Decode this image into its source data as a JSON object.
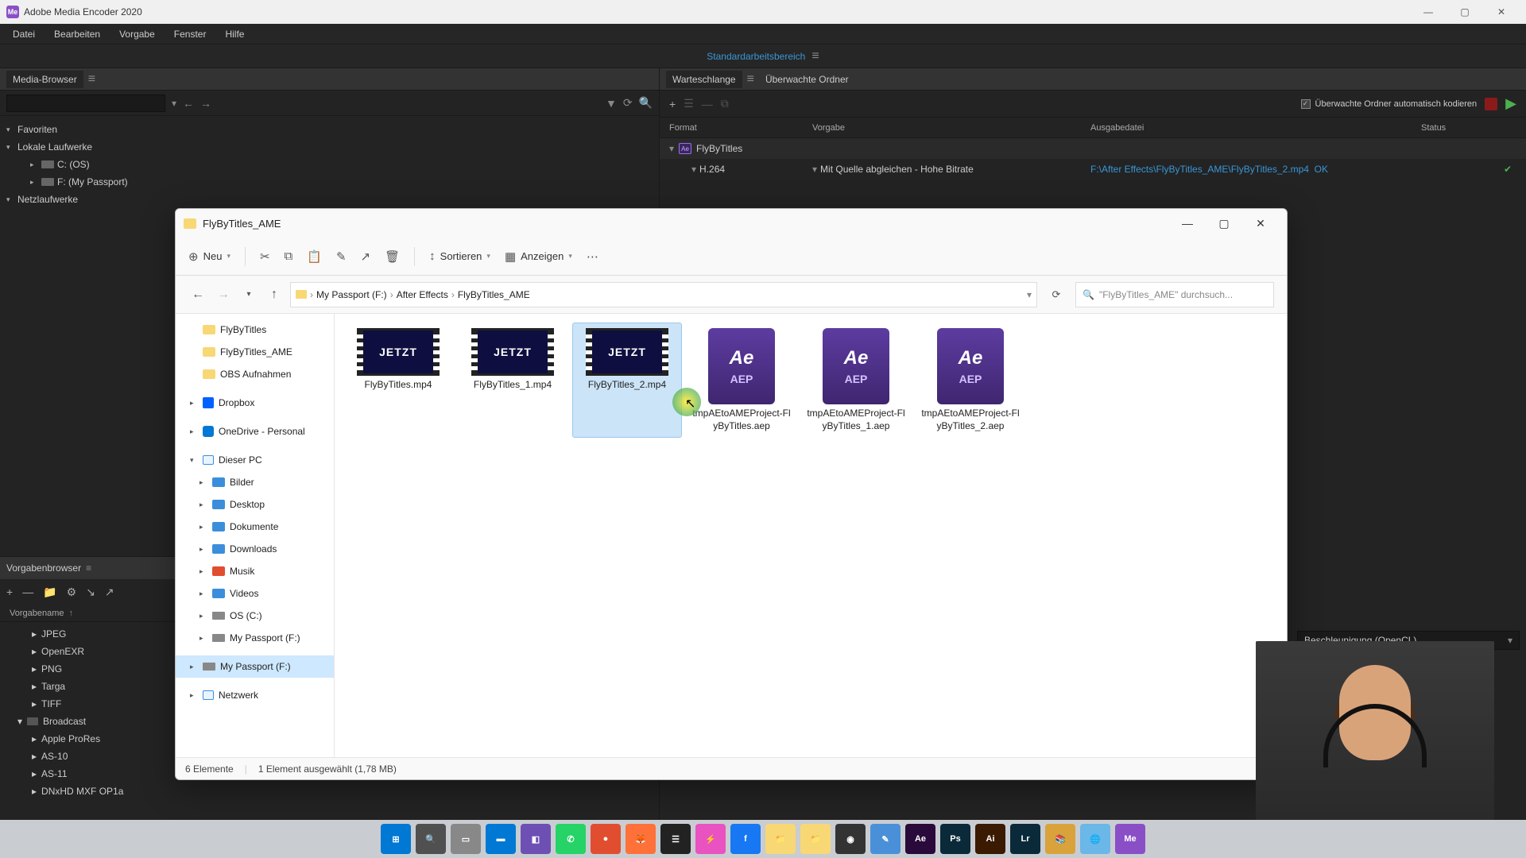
{
  "ame": {
    "title": "Adobe Media Encoder 2020",
    "menu": [
      "Datei",
      "Bearbeiten",
      "Vorgabe",
      "Fenster",
      "Hilfe"
    ],
    "workspace": "Standardarbeitsbereich",
    "left_panel": {
      "title": "Media-Browser",
      "tree": {
        "fav": "Favoriten",
        "local": "Lokale Laufwerke",
        "c": "C: (OS)",
        "f": "F: (My Passport)",
        "net": "Netzlaufwerke"
      }
    },
    "preset_panel": {
      "title": "Vorgabenbrowser",
      "column": "Vorgabename",
      "groups": {
        "jpeg": "JPEG",
        "openexr": "OpenEXR",
        "png": "PNG",
        "targa": "Targa",
        "tiff": "TIFF",
        "broadcast": "Broadcast",
        "prores": "Apple ProRes",
        "as10": "AS-10",
        "as11": "AS-11",
        "dnxhd": "DNxHD MXF OP1a"
      }
    },
    "queue": {
      "tab1": "Warteschlange",
      "tab2": "Überwachte Ordner",
      "auto_encode": "Überwachte Ordner automatisch kodieren",
      "headers": {
        "format": "Format",
        "preset": "Vorgabe",
        "output": "Ausgabedatei",
        "status": "Status"
      },
      "item": {
        "name": "FlyByTitles",
        "format": "H.264",
        "preset": "Mit Quelle abgleichen - Hohe Bitrate",
        "output": "F:\\After Effects\\FlyByTitles_AME\\FlyByTitles_2.mp4",
        "status": "OK"
      },
      "accel": "Beschleunigung (OpenCL)"
    }
  },
  "explorer": {
    "title": "FlyByTitles_AME",
    "toolbar": {
      "new": "Neu",
      "sort": "Sortieren",
      "view": "Anzeigen"
    },
    "breadcrumb": [
      "My Passport (F:)",
      "After Effects",
      "FlyByTitles_AME"
    ],
    "search_placeholder": "\"FlyByTitles_AME\" durchsuch...",
    "side": {
      "quick": [
        "FlyByTitles",
        "FlyByTitles_AME",
        "OBS Aufnahmen"
      ],
      "dropbox": "Dropbox",
      "onedrive": "OneDrive - Personal",
      "thispc": "Dieser PC",
      "pc_items": [
        "Bilder",
        "Desktop",
        "Dokumente",
        "Downloads",
        "Musik",
        "Videos",
        "OS (C:)",
        "My Passport (F:)"
      ],
      "selected": "My Passport (F:)",
      "network": "Netzwerk"
    },
    "files": [
      {
        "name": "FlyByTitles.mp4",
        "type": "video",
        "thumb_text": "JETZT"
      },
      {
        "name": "FlyByTitles_1.mp4",
        "type": "video",
        "thumb_text": "JETZT"
      },
      {
        "name": "FlyByTitles_2.mp4",
        "type": "video",
        "thumb_text": "JETZT",
        "selected": true
      },
      {
        "name": "tmpAEtoAMEProject-FlyByTitles.aep",
        "type": "aep"
      },
      {
        "name": "tmpAEtoAMEProject-FlyByTitles_1.aep",
        "type": "aep"
      },
      {
        "name": "tmpAEtoAMEProject-FlyByTitles_2.aep",
        "type": "aep"
      }
    ],
    "status": {
      "count": "6 Elemente",
      "selection": "1 Element ausgewählt (1,78 MB)"
    }
  },
  "taskbar_icons": [
    {
      "bg": "#0078d4",
      "txt": "⊞"
    },
    {
      "bg": "#505050",
      "txt": "🔍"
    },
    {
      "bg": "#888",
      "txt": "▭"
    },
    {
      "bg": "#0078d4",
      "txt": "▬"
    },
    {
      "bg": "#6e4fb3",
      "txt": "◧"
    },
    {
      "bg": "#25d366",
      "txt": "✆"
    },
    {
      "bg": "#e04e2f",
      "txt": "●"
    },
    {
      "bg": "#ff7139",
      "txt": "🦊"
    },
    {
      "bg": "#222",
      "txt": "☰"
    },
    {
      "bg": "#e952c1",
      "txt": "⚡"
    },
    {
      "bg": "#1877f2",
      "txt": "f"
    },
    {
      "bg": "#f8d775",
      "txt": "📁"
    },
    {
      "bg": "#f8d775",
      "txt": "📁"
    },
    {
      "bg": "#333",
      "txt": "◉"
    },
    {
      "bg": "#4a90d9",
      "txt": "✎"
    },
    {
      "bg": "#2a0a3a",
      "txt": "Ae"
    },
    {
      "bg": "#0a2a3a",
      "txt": "Ps"
    },
    {
      "bg": "#3a1a00",
      "txt": "Ai"
    },
    {
      "bg": "#0a2a3a",
      "txt": "Lr"
    },
    {
      "bg": "#d9a23b",
      "txt": "📚"
    },
    {
      "bg": "#6ab7e8",
      "txt": "🌐"
    },
    {
      "bg": "#8a4fc7",
      "txt": "Me"
    }
  ]
}
